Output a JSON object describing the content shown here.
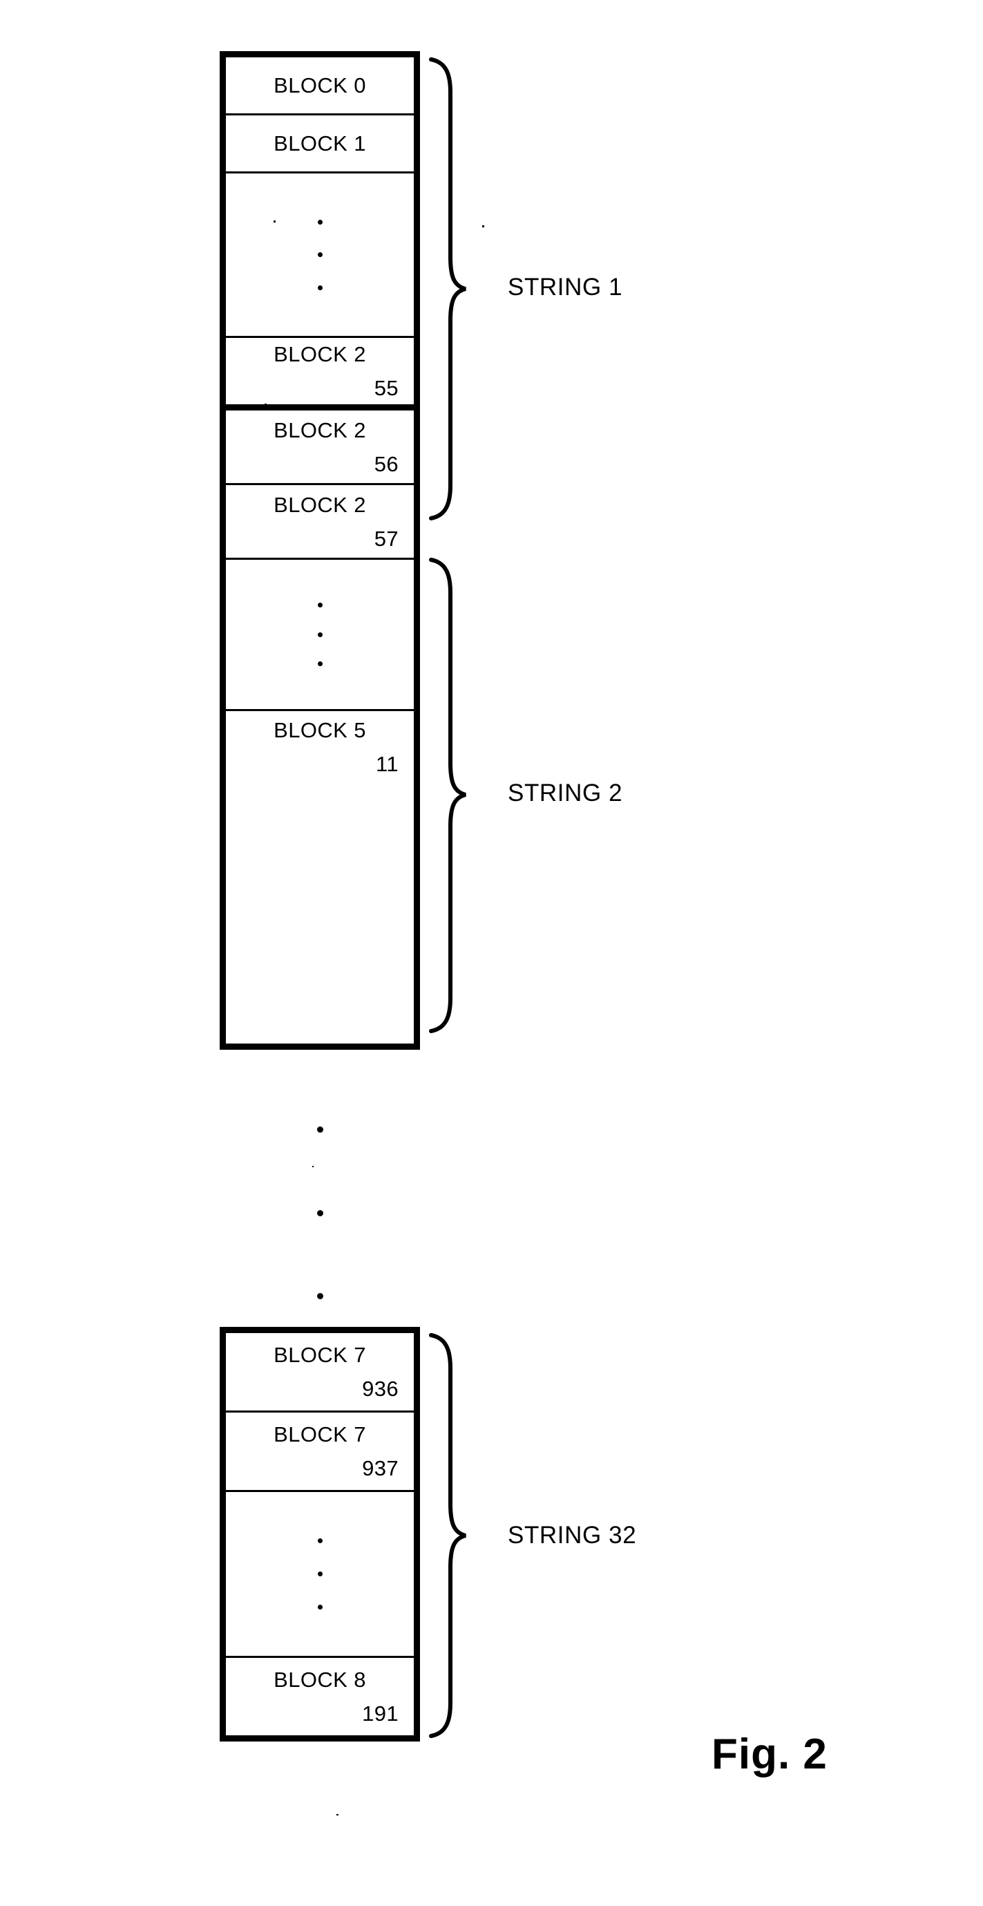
{
  "figure": {
    "caption": "Fig. 2"
  },
  "arrays": [
    {
      "id": "array-top",
      "cells": [
        {
          "line1": "BLOCK 0",
          "line2": "",
          "kind": "block"
        },
        {
          "line1": "BLOCK 1",
          "line2": "",
          "kind": "block"
        },
        {
          "line1": "",
          "line2": "",
          "kind": "ellipsis"
        },
        {
          "line1": "BLOCK 2",
          "line2": "55",
          "kind": "block",
          "break_after": true
        },
        {
          "line1": "BLOCK 2",
          "line2": "56",
          "kind": "block"
        },
        {
          "line1": "BLOCK 2",
          "line2": "57",
          "kind": "block"
        },
        {
          "line1": "",
          "line2": "",
          "kind": "ellipsis"
        },
        {
          "line1": "BLOCK 5",
          "line2": "11",
          "kind": "block"
        }
      ]
    },
    {
      "id": "array-bottom",
      "cells": [
        {
          "line1": "BLOCK 7",
          "line2": "936",
          "kind": "block"
        },
        {
          "line1": "BLOCK 7",
          "line2": "937",
          "kind": "block"
        },
        {
          "line1": "",
          "line2": "",
          "kind": "ellipsis"
        },
        {
          "line1": "BLOCK 8",
          "line2": "191",
          "kind": "block"
        }
      ]
    }
  ],
  "strings": [
    {
      "label": "STRING 1"
    },
    {
      "label": "STRING 2"
    },
    {
      "label": "STRING 32"
    }
  ],
  "colors": {
    "ink": "#000000",
    "paper": "#ffffff"
  }
}
